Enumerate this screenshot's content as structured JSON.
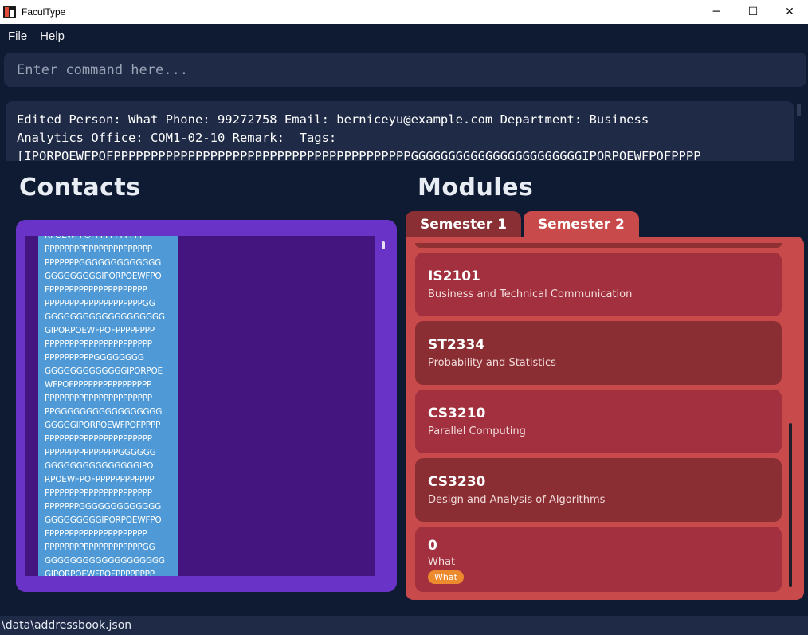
{
  "window": {
    "title": "FaculType",
    "icon": "app-logo-icon",
    "controls": {
      "minimize": "─",
      "maximize": "☐",
      "close": "✕"
    }
  },
  "menu": {
    "items": [
      "File",
      "Help"
    ]
  },
  "command": {
    "placeholder": "Enter command here...",
    "value": ""
  },
  "result": {
    "lines": [
      "Edited Person: What Phone: 99272758 Email: berniceyu@example.com Department: Business",
      "Analytics Office: COM1-02-10 Remark:  Tags:",
      "[IPORPOEWFPOFPPPPPPPPPPPPPPPPPPPPPPPPPPPPPPPPPPPPPPPPGGGGGGGGGGGGGGGGGGGGGGGIPORPOEWFPOFPPPP"
    ]
  },
  "contacts": {
    "heading": "Contacts",
    "tag_lines": [
      "RPOEWFPOFPPPPPPPPPP",
      "PPPPPPPPPPPPPPPPPPPPPP",
      "PPPPPPPGGGGGGGGGGGGG",
      "GGGGGGGGGIPORPOEWFPO",
      "FPPPPPPPPPPPPPPPPPPPP",
      "PPPPPPPPPPPPPPPPPPPPGG",
      "GGGGGGGGGGGGGGGGGGG",
      "GIPORPOEWFPOFPPPPPPPP",
      "PPPPPPPPPPPPPPPPPPPPPP",
      "PPPPPPPPPPGGGGGGGG",
      "GGGGGGGGGGGGGIPORPOE",
      "WFPOFPPPPPPPPPPPPPPPP",
      "PPPPPPPPPPPPPPPPPPPPPP",
      "PPGGGGGGGGGGGGGGGGG",
      "GGGGGIPORPOEWFPOFPPPP",
      "PPPPPPPPPPPPPPPPPPPPPP",
      "PPPPPPPPPPPPPPPGGGGGG",
      "GGGGGGGGGGGGGGGIPO",
      "RPOEWFPOFPPPPPPPPPPPP",
      "PPPPPPPPPPPPPPPPPPPPPP",
      "PPPPPPPGGGGGGGGGGGGG",
      "GGGGGGGGGIPORPOEWFPO",
      "FPPPPPPPPPPPPPPPPPPPP",
      "PPPPPPPPPPPPPPPPPPPPGG",
      "GGGGGGGGGGGGGGGGGGG",
      "GIPORPOEWFPOFPPPPPPPP"
    ]
  },
  "modules": {
    "heading": "Modules",
    "tabs": [
      {
        "label": "Semester 1",
        "active": false
      },
      {
        "label": "Semester 2",
        "active": true
      }
    ],
    "cards": [
      {
        "code": "IS2101",
        "name": "Business and Technical Communication",
        "tag": ""
      },
      {
        "code": "ST2334",
        "name": "Probability and Statistics",
        "tag": ""
      },
      {
        "code": "CS3210",
        "name": "Parallel Computing",
        "tag": ""
      },
      {
        "code": "CS3230",
        "name": "Design and Analysis of Algorithms",
        "tag": ""
      },
      {
        "code": "0",
        "name": "What",
        "tag": "What"
      }
    ]
  },
  "status": {
    "path": "\\data\\addressbook.json"
  },
  "colors": {
    "background": "#0f1b33",
    "contacts_panel": "#6a33c7",
    "contacts_list": "#44157f",
    "tag_blue": "#4f9ad6",
    "modules_panel": "#c84a4a",
    "card_light": "#a2303e",
    "card_dark": "#8b2e33",
    "tag_orange": "#ee8a2e"
  }
}
